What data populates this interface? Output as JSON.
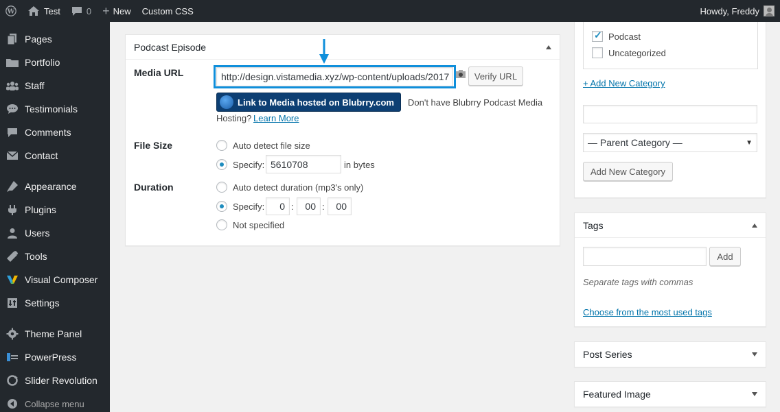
{
  "adminbar": {
    "site_name": "Test",
    "comments_count": "0",
    "new_label": "New",
    "custom_css": "Custom CSS",
    "howdy": "Howdy, Freddy"
  },
  "sidebar": {
    "items": [
      {
        "label": "Pages",
        "icon": "pages-icon"
      },
      {
        "label": "Portfolio",
        "icon": "portfolio-icon"
      },
      {
        "label": "Staff",
        "icon": "staff-icon"
      },
      {
        "label": "Testimonials",
        "icon": "testimonials-icon"
      },
      {
        "label": "Comments",
        "icon": "comments-icon"
      },
      {
        "label": "Contact",
        "icon": "contact-icon"
      },
      {
        "label": "Appearance",
        "icon": "appearance-icon"
      },
      {
        "label": "Plugins",
        "icon": "plugins-icon"
      },
      {
        "label": "Users",
        "icon": "users-icon"
      },
      {
        "label": "Tools",
        "icon": "tools-icon"
      },
      {
        "label": "Visual Composer",
        "icon": "visual-composer-icon"
      },
      {
        "label": "Settings",
        "icon": "settings-icon"
      },
      {
        "label": "Theme Panel",
        "icon": "theme-panel-icon"
      },
      {
        "label": "PowerPress",
        "icon": "powerpress-icon"
      },
      {
        "label": "Slider Revolution",
        "icon": "slider-revolution-icon"
      }
    ],
    "collapse_label": "Collapse menu"
  },
  "podcast": {
    "title": "Podcast Episode",
    "media_url_label": "Media URL",
    "media_url_value": "http://design.vistamedia.xyz/wp-content/uploads/2017",
    "verify_button": "Verify URL",
    "blubrry_button": "Link to Media hosted on Blubrry.com",
    "hosting_text_1": "Don't have Blubrry Podcast Media",
    "hosting_text_2": "Hosting?",
    "learn_more": "Learn More",
    "file_size_label": "File Size",
    "auto_detect_size": "Auto detect file size",
    "specify_label": "Specify:",
    "file_size_value": "5610708",
    "in_bytes": "in bytes",
    "duration_label": "Duration",
    "auto_detect_duration": "Auto detect duration (mp3's only)",
    "duration_h": "0",
    "duration_m": "00",
    "duration_s": "00",
    "colon": ":",
    "not_specified": "Not specified"
  },
  "categories": {
    "items": [
      {
        "label": "Podcast",
        "checked": true
      },
      {
        "label": "Uncategorized",
        "checked": false
      }
    ],
    "add_new_link": "+ Add New Category",
    "parent_category": "— Parent Category —",
    "add_new_button": "Add New Category"
  },
  "tags": {
    "title": "Tags",
    "add_button": "Add",
    "hint": "Separate tags with commas",
    "choose_link": "Choose from the most used tags"
  },
  "post_series": {
    "title": "Post Series"
  },
  "featured_image": {
    "title": "Featured Image"
  },
  "colors": {
    "admin_bar_bg": "#23282d",
    "highlight": "#0f8fdb",
    "link": "#0073aa",
    "blubrry_bg": "#0d3f73"
  }
}
